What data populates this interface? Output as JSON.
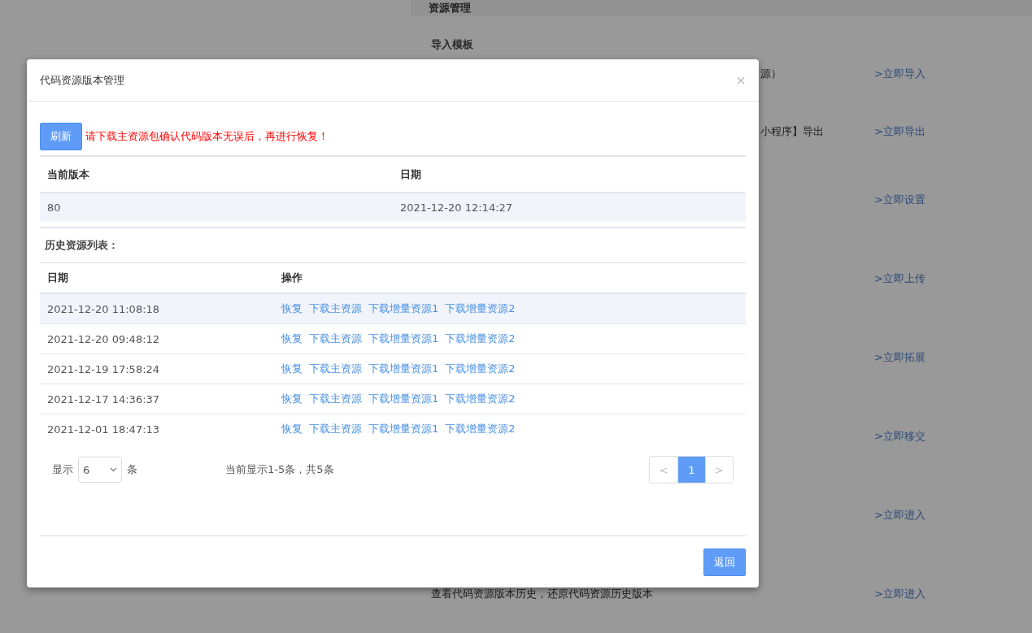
{
  "page": {
    "header": "资源管理",
    "section_title": "导入模板",
    "rows": [
      {
        "description": "源）",
        "link": ">立即导入"
      },
      {
        "description": "小程序】导出",
        "link": ">立即导出"
      },
      {
        "link": ">立即设置"
      },
      {
        "link": ">立即上传"
      },
      {
        "link": ">立即拓展"
      },
      {
        "link": ">立即移交"
      },
      {
        "link": ">立即进入"
      },
      {
        "description": "查看代码资源版本历史，还原代码资源历史版本",
        "link": ">立即进入"
      }
    ]
  },
  "dialog": {
    "title": "代码资源版本管理",
    "close": "×",
    "refresh_button": "刷新",
    "warning": "请下载主资源包确认代码版本无误后，再进行恢复！",
    "current": {
      "columns": [
        "当前版本",
        "日期"
      ],
      "row": [
        "80",
        "2021-12-20 12:14:27"
      ]
    },
    "history_title": "历史资源列表：",
    "history": {
      "columns": [
        "日期",
        "操作"
      ],
      "rows": [
        {
          "date": "2021-12-20 11:08:18",
          "selected": true,
          "actions": [
            "恢复",
            "下载主资源",
            "下载增量资源1",
            "下载增量资源2"
          ]
        },
        {
          "date": "2021-12-20 09:48:12",
          "selected": false,
          "actions": [
            "恢复",
            "下载主资源",
            "下载增量资源1",
            "下载增量资源2"
          ]
        },
        {
          "date": "2021-12-19 17:58:24",
          "selected": false,
          "actions": [
            "恢复",
            "下载主资源",
            "下载增量资源1",
            "下载增量资源2"
          ]
        },
        {
          "date": "2021-12-17 14:36:37",
          "selected": false,
          "actions": [
            "恢复",
            "下载主资源",
            "下载增量资源1",
            "下载增量资源2"
          ]
        },
        {
          "date": "2021-12-01 18:47:13",
          "selected": false,
          "actions": [
            "恢复",
            "下载主资源",
            "下载增量资源1",
            "下载增量资源2"
          ]
        }
      ]
    },
    "pager": {
      "show_label": "显示",
      "page_size": "6",
      "unit": "条",
      "summary": "当前显示1-5条，共5条",
      "prev": "<",
      "pages": [
        {
          "label": "1",
          "selected": true
        }
      ],
      "next": ">"
    },
    "back_button": "返回"
  }
}
